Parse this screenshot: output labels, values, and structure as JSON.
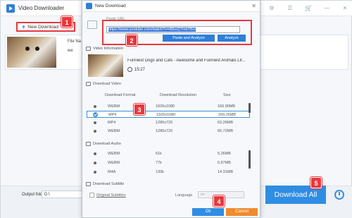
{
  "app": {
    "title": "Video Downloader",
    "new_download_label": "New Download",
    "file_name_label": "File Na",
    "we_label": "we",
    "output_folder_label": "Output folder:",
    "output_folder_value": "D:\\",
    "download_all_label": "Download All"
  },
  "dialog": {
    "title": "New Download",
    "paste_url_label": "Paste URL",
    "url_value": "https://www.youtube.com/watch?v=d5kxQ7mbTBU",
    "paste_analyze_label": "Paste and Analyze",
    "analyze_label": "Analyze",
    "video_info_label": "Video Information",
    "video_title": "Funniest Dogs and Cats - Awesome and Funniest Animals Lif...",
    "video_duration": "15:27",
    "download_video_label": "Download Video",
    "video_columns": [
      "Download Format",
      "Download Resolution",
      "Size"
    ],
    "video_rows": [
      {
        "format": "WEBM",
        "resolution": "1920x1080",
        "size": "166.90MB",
        "selected": false
      },
      {
        "format": "MP4",
        "resolution": "1920x1080",
        "size": "209.26MB",
        "selected": true
      },
      {
        "format": "MP4",
        "resolution": "1280x720",
        "size": "63.26MB",
        "selected": false
      },
      {
        "format": "WEBM",
        "resolution": "1280x720",
        "size": "65.72MB",
        "selected": false
      }
    ],
    "download_audio_label": "Download Audio",
    "audio_rows": [
      {
        "format": "WEBM",
        "quality": "61k",
        "size": "5.26MB"
      },
      {
        "format": "WEBM",
        "quality": "77k",
        "size": "5.67MB"
      },
      {
        "format": "M4A",
        "quality": "130k",
        "size": "14.31MB"
      }
    ],
    "download_subtitle_label": "Download Subtitle",
    "original_subtitles_label": "Original Subtitles",
    "language_label": "Language",
    "language_value": "en",
    "ok_label": "Ok",
    "cancel_label": "Cancel"
  },
  "badges": [
    "1",
    "2",
    "3",
    "4",
    "5"
  ],
  "colors": {
    "accent": "#2f8de4",
    "highlight": "#e8383d",
    "cancel": "#f08b2e"
  },
  "icons": [
    "app-logo-icon",
    "cart-icon",
    "minimize-icon",
    "close-icon",
    "link-icon",
    "clock-icon",
    "alarm-icon"
  ]
}
